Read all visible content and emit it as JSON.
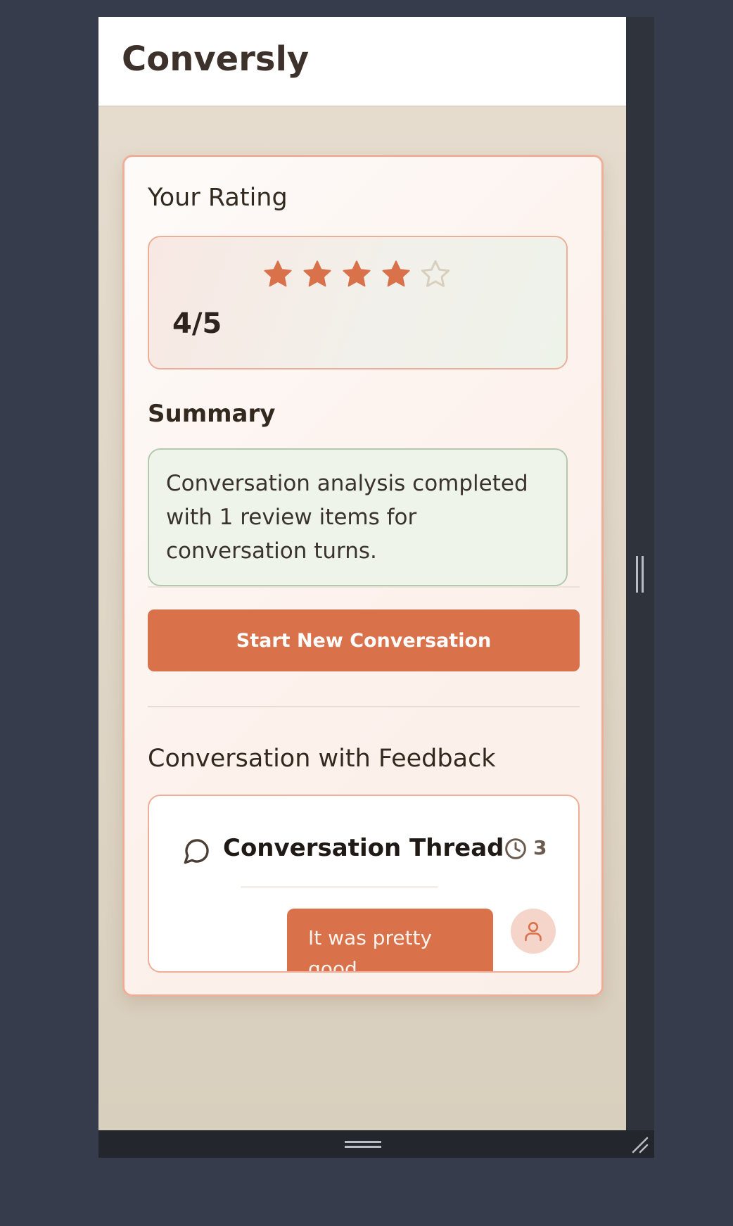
{
  "app": {
    "title": "Conversly"
  },
  "rating": {
    "title": "Your Rating",
    "value": 4,
    "max": 5,
    "display": "4/5",
    "star_color": "#d9714b",
    "empty_star_color": "#d9cfbe"
  },
  "summary": {
    "title": "Summary",
    "text": "Conversation analysis completed with 1 review items for conversation turns."
  },
  "actions": {
    "start_label": "Start New Conversation"
  },
  "feedback": {
    "title": "Conversation with Feedback",
    "thread": {
      "title": "Conversation Thread",
      "turn_count": "3",
      "message": "It was pretty good"
    }
  },
  "colors": {
    "accent": "#d9714b",
    "card_border": "#eeae97",
    "summary_bg": "#eff4eb",
    "page_bg": "#e6ddd0"
  },
  "icons": {
    "thread": "speech-bubble-icon",
    "turns": "clock-icon",
    "avatar": "user-icon",
    "resize": "resize-corner-icon"
  }
}
